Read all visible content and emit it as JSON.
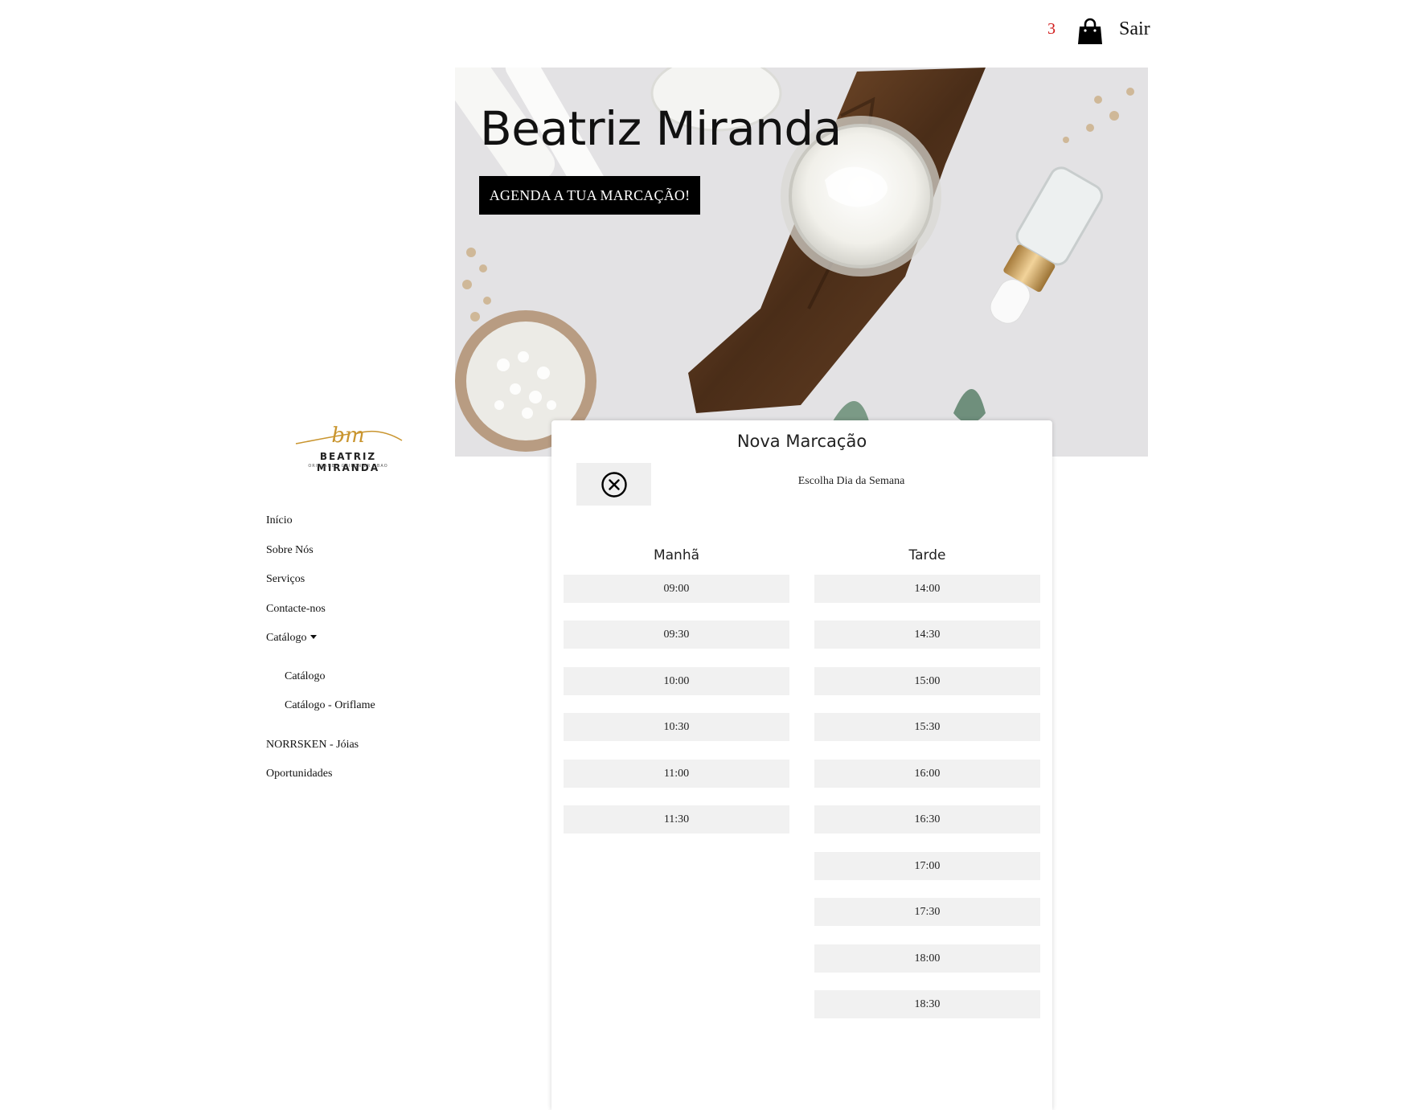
{
  "topbar": {
    "cart_count": "3",
    "bag_icon": "shopping-bag-icon",
    "logout_label": "Sair",
    "cart_count_color": "#d11a1a"
  },
  "hero": {
    "title": "Beatriz Miranda",
    "cta_label": "AGENDA A TUA MARCAÇÃO!"
  },
  "logo": {
    "monogram": "bm",
    "brand": "BEATRIZ MIRANDA",
    "tagline": "ORIFLAME · GRIFONIER · BAO",
    "accent": "#c9952f"
  },
  "nav": {
    "items": [
      {
        "label": "Início"
      },
      {
        "label": "Sobre Nós"
      },
      {
        "label": "Serviços"
      },
      {
        "label": "Contacte-nos"
      },
      {
        "label": "Catálogo"
      },
      {
        "label": "NORRSKEN - Jóias"
      },
      {
        "label": "Oportunidades"
      }
    ],
    "submenu": [
      {
        "label": "Catálogo"
      },
      {
        "label": "Catálogo - Oriflame"
      }
    ]
  },
  "modal": {
    "title": "Nova Marcação",
    "close_icon": "close-circle-icon",
    "choose_day": "Escolha Dia da Semana",
    "morning_label": "Manhã",
    "afternoon_label": "Tarde",
    "morning_slots": [
      "09:00",
      "09:30",
      "10:00",
      "10:30",
      "11:00",
      "11:30"
    ],
    "afternoon_slots": [
      "14:00",
      "14:30",
      "15:00",
      "15:30",
      "16:00",
      "16:30",
      "17:00",
      "17:30",
      "18:00",
      "18:30"
    ]
  }
}
